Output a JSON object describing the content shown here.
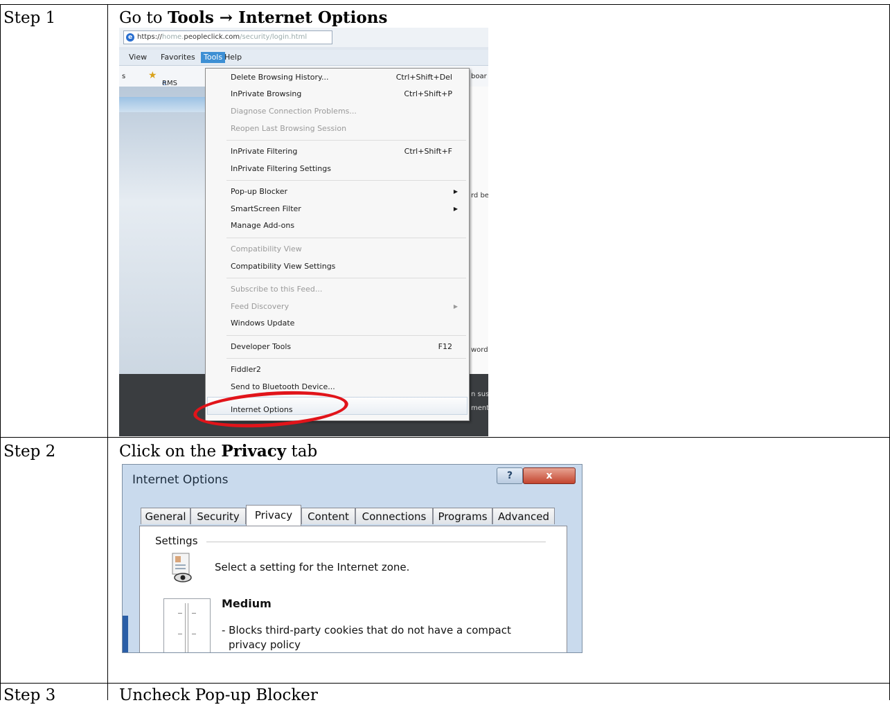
{
  "steps": [
    {
      "label": "Step 1",
      "title_prefix": "Go to ",
      "title_bold": "Tools → Internet Options"
    },
    {
      "label": "Step 2",
      "title_prefix": "Click on the ",
      "title_bold": "Privacy",
      "title_suffix": " tab"
    },
    {
      "label": "Step 3",
      "title": "Uncheck Pop-up Blocker"
    }
  ],
  "browser": {
    "address_prefix": "https://",
    "address_dim1": "home.",
    "address_main": "peopleclick.com",
    "address_dim2": "/security/login.html",
    "menubar": [
      "View",
      "Favorites",
      "Tools",
      "Help"
    ],
    "favorites": [
      "s",
      "RMS",
      "boar"
    ],
    "right_fragments": [
      "rd be",
      "word",
      "n sus",
      "ment"
    ]
  },
  "tools_menu": {
    "items": [
      {
        "label": "Delete Browsing History...",
        "shortcut": "Ctrl+Shift+Del"
      },
      {
        "label": "InPrivate Browsing",
        "shortcut": "Ctrl+Shift+P"
      },
      {
        "label": "Diagnose Connection Problems...",
        "disabled": true
      },
      {
        "label": "Reopen Last Browsing Session",
        "disabled": true
      },
      {
        "label": "InPrivate Filtering",
        "shortcut": "Ctrl+Shift+F"
      },
      {
        "label": "InPrivate Filtering Settings"
      },
      {
        "label": "Pop-up Blocker",
        "submenu": true
      },
      {
        "label": "SmartScreen Filter",
        "submenu": true
      },
      {
        "label": "Manage Add-ons"
      },
      {
        "label": "Compatibility View",
        "disabled": true
      },
      {
        "label": "Compatibility View Settings"
      },
      {
        "label": "Subscribe to this Feed...",
        "disabled": true
      },
      {
        "label": "Feed Discovery",
        "disabled": true,
        "submenu": true
      },
      {
        "label": "Windows Update"
      },
      {
        "label": "Developer Tools",
        "shortcut": "F12"
      },
      {
        "label": "Fiddler2"
      },
      {
        "label": "Send to Bluetooth Device..."
      },
      {
        "label": "Internet Options",
        "highlighted": true
      }
    ]
  },
  "dialog": {
    "title": "Internet Options",
    "help_glyph": "?",
    "close_glyph": "x",
    "tabs": [
      "General",
      "Security",
      "Privacy",
      "Content",
      "Connections",
      "Programs",
      "Advanced"
    ],
    "selected_tab": "Privacy",
    "group_label": "Settings",
    "prompt": "Select a setting for the Internet zone.",
    "level": "Medium",
    "level_desc_line1": "- Blocks third-party cookies that do not have a compact",
    "level_desc_line2": "privacy policy"
  },
  "colors": {
    "annotation_oval": "#e1141a",
    "menu_active": "#3d8fd4",
    "dialog_frame": "#c9daed"
  }
}
